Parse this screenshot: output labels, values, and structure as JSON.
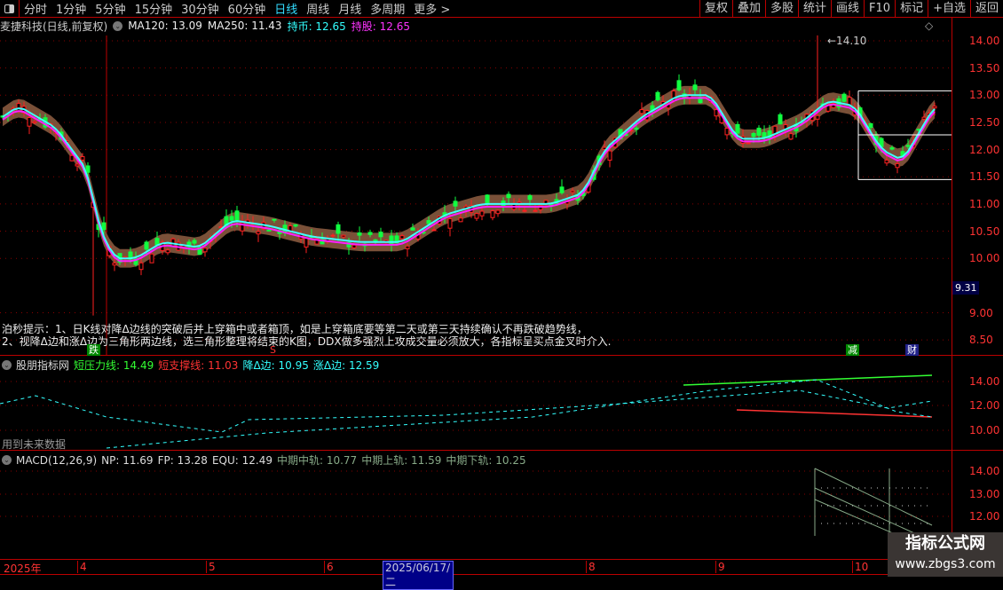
{
  "toolbar": {
    "periods": [
      "分时",
      "1分钟",
      "5分钟",
      "15分钟",
      "30分钟",
      "60分钟",
      "日线",
      "周线",
      "月线",
      "多周期",
      "更多 >"
    ],
    "active_period": "日线",
    "right_buttons": [
      "复权",
      "叠加",
      "多股",
      "统计",
      "画线",
      "F10",
      "标记",
      "+自选",
      "返回"
    ]
  },
  "title": {
    "stock": "麦捷科技(日线,前复权)",
    "ma120": "MA120: 13.09",
    "ma250": "MA250: 11.43",
    "chibi": "持币: 12.65",
    "chigu": "持股: 12.65"
  },
  "main": {
    "y_labels": [
      "14.00",
      "13.50",
      "13.00",
      "12.50",
      "12.00",
      "11.50",
      "11.00",
      "10.50",
      "10.00",
      "9.00",
      "8.50"
    ],
    "y_values": [
      14,
      13.5,
      13,
      12.5,
      12,
      11.5,
      11,
      10.5,
      10,
      9,
      8.5
    ],
    "current_price": "9.31",
    "high_marker": "14.10",
    "hint1": "泊秒提示：1、日K线对降Δ边线的突破后并上穿箱中或者箱顶，如是上穿箱底要等第二天或第三天持续确认不再跌破趋势线，",
    "hint2": "2、视降Δ边和涨Δ边为三角形两边线，选三角形整理将结束的K图，DDX做多强烈上攻成交量必须放大，各指标呈买点金叉时介入.",
    "signals": [
      "跌",
      "S",
      "减",
      "财"
    ],
    "colors": {
      "up": "#ff2020",
      "down": "#10ff40",
      "band": "#7a5038",
      "ma_fast": "#40ffff",
      "ma_slow": "#ff20ff"
    }
  },
  "chart_data": {
    "type": "candlestick",
    "title": "麦捷科技(日线,前复权)",
    "ylim": [
      8.3,
      14.3
    ],
    "close_path": [
      [
        0,
        12.6
      ],
      [
        3,
        12.8
      ],
      [
        10,
        12.4
      ],
      [
        16,
        11.6
      ],
      [
        18,
        10.6
      ],
      [
        21,
        10.0
      ],
      [
        25,
        10.0
      ],
      [
        30,
        10.3
      ],
      [
        37,
        10.2
      ],
      [
        43,
        10.7
      ],
      [
        50,
        10.6
      ],
      [
        58,
        10.4
      ],
      [
        67,
        10.3
      ],
      [
        75,
        10.3
      ],
      [
        83,
        10.8
      ],
      [
        90,
        11.0
      ],
      [
        97,
        11.0
      ],
      [
        103,
        11.0
      ],
      [
        109,
        11.2
      ],
      [
        113,
        12.0
      ],
      [
        120,
        12.6
      ],
      [
        127,
        13.0
      ],
      [
        133,
        13.0
      ],
      [
        138,
        12.2
      ],
      [
        143,
        12.2
      ],
      [
        150,
        12.5
      ],
      [
        155,
        12.9
      ],
      [
        160,
        12.8
      ],
      [
        165,
        12.0
      ],
      [
        169,
        11.8
      ],
      [
        172,
        12.3
      ],
      [
        175,
        12.8
      ]
    ],
    "high": 14.1,
    "box_levels": [
      13.08,
      12.27,
      11.45
    ]
  },
  "indicator": {
    "name": "股朋指标网",
    "short_pressure": "短压力线: 14.49",
    "short_support": "短支撑线: 11.03",
    "down_edge": "降Δ边: 10.95",
    "up_edge": "涨Δ边: 12.59",
    "note": "用到未来数据",
    "y_labels": [
      "14.00",
      "12.00",
      "10.00"
    ]
  },
  "macd": {
    "name": "MACD(12,26,9)",
    "np": "NP: 11.69",
    "fp": "FP: 13.28",
    "equ": "EQU: 12.49",
    "mid": "中期中轨: 10.77",
    "upper": "中期上轨: 11.59",
    "lower": "中期下轨: 10.25",
    "y_labels": [
      "14.00",
      "13.00",
      "12.00"
    ]
  },
  "dates": {
    "labels": [
      "2025年",
      "4",
      "5",
      "6",
      "2025/06/17/二",
      "8",
      "9",
      "10"
    ]
  },
  "watermark": {
    "line1": "指标公式网",
    "line2": "www.zbgs3.com"
  }
}
